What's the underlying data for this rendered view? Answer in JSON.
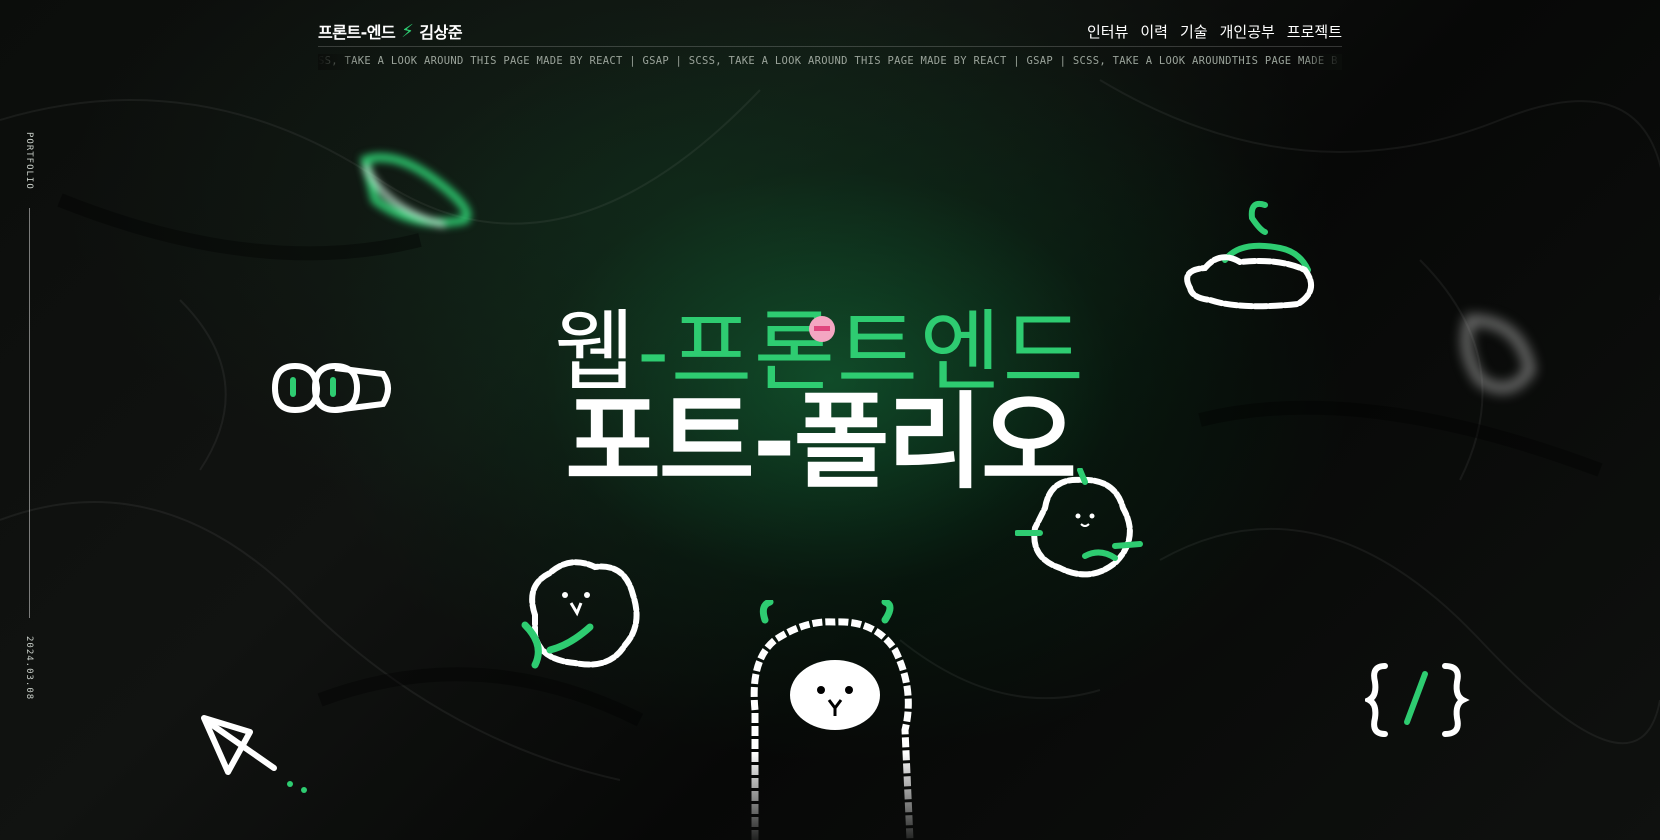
{
  "header": {
    "logo_left": "프론트-엔드",
    "logo_icon": "lightning-icon",
    "logo_right": "김상준",
    "nav": [
      "인터뷰",
      "이력",
      "기술",
      "개인공부",
      "프로젝트"
    ]
  },
  "marquee": {
    "text": "SS, TAKE A LOOK AROUND        THIS PAGE MADE BY REACT | GSAP | SCSS, TAKE A LOOK AROUND        THIS PAGE MADE BY REACT | GSAP | SCSS, TAKE A LOOK AROUNDTHIS PAGE MADE B"
  },
  "side": {
    "label": "PORTFOLIO",
    "date": "2024.03.08"
  },
  "hero": {
    "line1_white": "웹",
    "line1_green": "-프론트엔드",
    "line2": "포트-폴리오"
  },
  "colors": {
    "accent": "#2ecc71",
    "background": "#070907",
    "text": "#ffffff"
  }
}
